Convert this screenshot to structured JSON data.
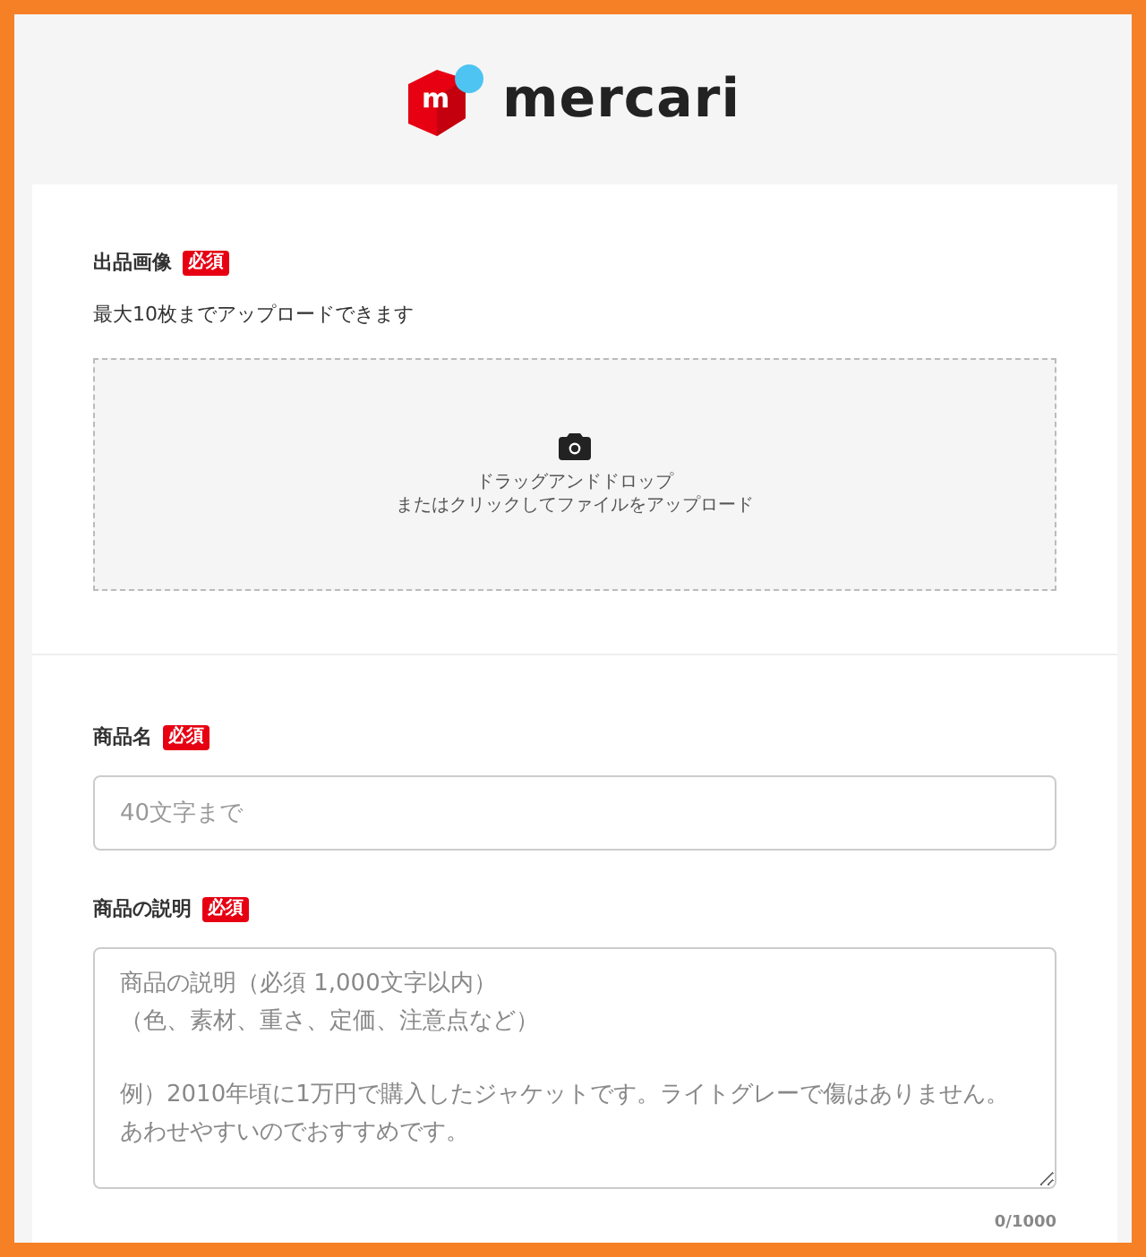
{
  "logo": {
    "mark": "m",
    "name": "mercari"
  },
  "image_section": {
    "label": "出品画像",
    "badge": "必須",
    "note": "最大10枚までアップロードできます",
    "dropzone": [
      "ドラッグアンドドロップ",
      "またはクリックしてファイルをアップロード"
    ]
  },
  "fields": [
    {
      "kind": "input",
      "label": "商品名",
      "badge": "必須",
      "placeholder": "40文字まで"
    },
    {
      "kind": "textarea",
      "label": "商品の説明",
      "badge": "必須",
      "placeholder": [
        [
          "商品の説明（必須 1,000文字以内）",
          "（色、素材、重さ、定価、注意点など）"
        ],
        [
          "例）2010年頃に1万円で購入したジャケットです。ライトグレーで傷はありません。あわせやすいのでおすすめです。"
        ]
      ],
      "counter": "0/1000"
    }
  ]
}
